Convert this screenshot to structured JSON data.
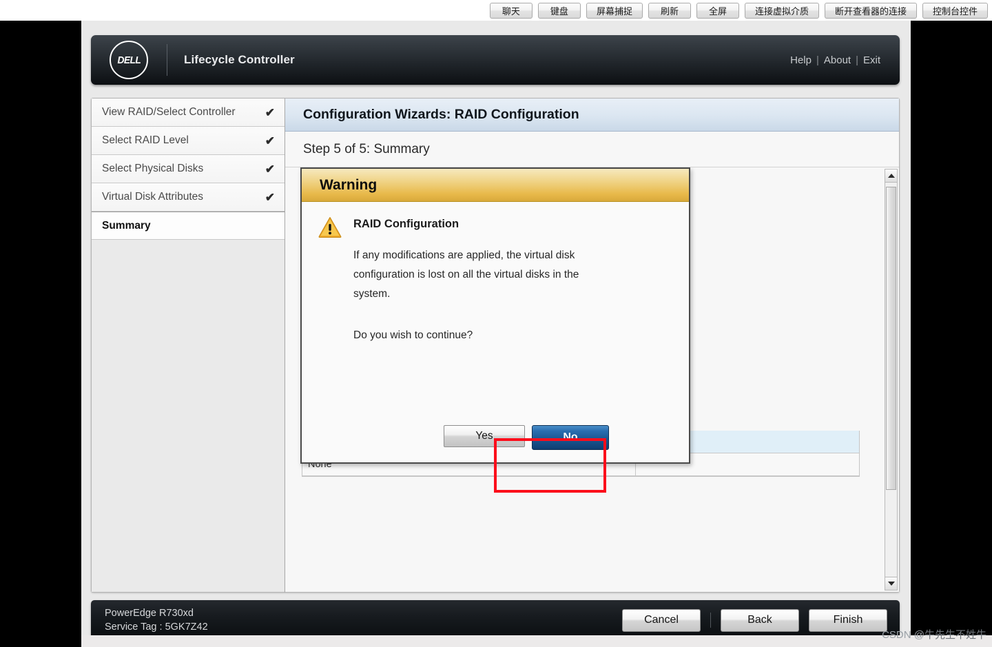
{
  "kvm_toolbar": {
    "buttons": [
      {
        "label": "聊天",
        "name": "kvm-chat-button"
      },
      {
        "label": "键盘",
        "name": "kvm-keyboard-button"
      },
      {
        "label": "屏幕捕捉",
        "name": "kvm-screen-capture-button"
      },
      {
        "label": "刷新",
        "name": "kvm-refresh-button"
      },
      {
        "label": "全屏",
        "name": "kvm-fullscreen-button"
      },
      {
        "label": "连接虚拟介质",
        "name": "kvm-connect-virtual-media-button"
      },
      {
        "label": "断开查看器的连接",
        "name": "kvm-disconnect-viewer-button"
      },
      {
        "label": "控制台控件",
        "name": "kvm-console-controls-button"
      }
    ]
  },
  "header": {
    "logo_text": "DELL",
    "title": "Lifecycle Controller",
    "links": {
      "help": "Help",
      "separator": "|",
      "about": "About",
      "exit": "Exit"
    }
  },
  "sidebar": {
    "items": [
      {
        "label": "View RAID/Select Controller",
        "check": "✔",
        "active": false
      },
      {
        "label": "Select RAID Level",
        "check": "✔",
        "active": false
      },
      {
        "label": "Select Physical Disks",
        "check": "✔",
        "active": false
      },
      {
        "label": "Virtual Disk Attributes",
        "check": "✔",
        "active": false
      },
      {
        "label": "Summary",
        "check": "",
        "active": true
      }
    ]
  },
  "main": {
    "panel_title": "Configuration Wizards: RAID Configuration",
    "step_text": "Step 5 of 5: Summary",
    "background_table": {
      "rows": [
        {
          "left": "",
          "right": ""
        },
        {
          "left": "None",
          "right": ""
        }
      ]
    }
  },
  "dialog": {
    "title": "Warning",
    "icon": "warning-triangle-icon",
    "subject": "RAID Configuration",
    "body": "If any modifications are applied, the virtual disk configuration is lost on all the virtual disks in the system.",
    "question": "Do you wish to continue?",
    "yes_label": "Yes",
    "no_label": "No"
  },
  "annotation": {
    "color": "#fc0d1b",
    "target": "Yes"
  },
  "footer": {
    "model": "PowerEdge R730xd",
    "service_tag": "Service Tag : 5GK7Z42",
    "cancel_label": "Cancel",
    "back_label": "Back",
    "finish_label": "Finish"
  },
  "watermark": {
    "prefix": "CSDN @",
    "user": "牛先生不姓牛"
  },
  "colors": {
    "accent_blue": "#18548f",
    "warning_gold": "#e8b94a",
    "annotation_red": "#fc0d1b",
    "panel_header": "#dbe6f1"
  }
}
